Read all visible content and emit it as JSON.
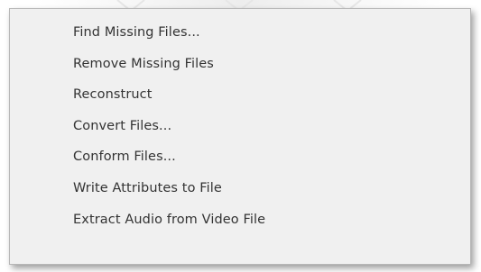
{
  "context_menu": {
    "items": [
      {
        "label": "Find Missing Files..."
      },
      {
        "label": "Remove Missing Files"
      },
      {
        "label": "Reconstruct"
      },
      {
        "label": "Convert Files..."
      },
      {
        "label": "Conform Files..."
      },
      {
        "label": "Write Attributes to File"
      },
      {
        "label": "Extract Audio from Video File"
      }
    ]
  }
}
